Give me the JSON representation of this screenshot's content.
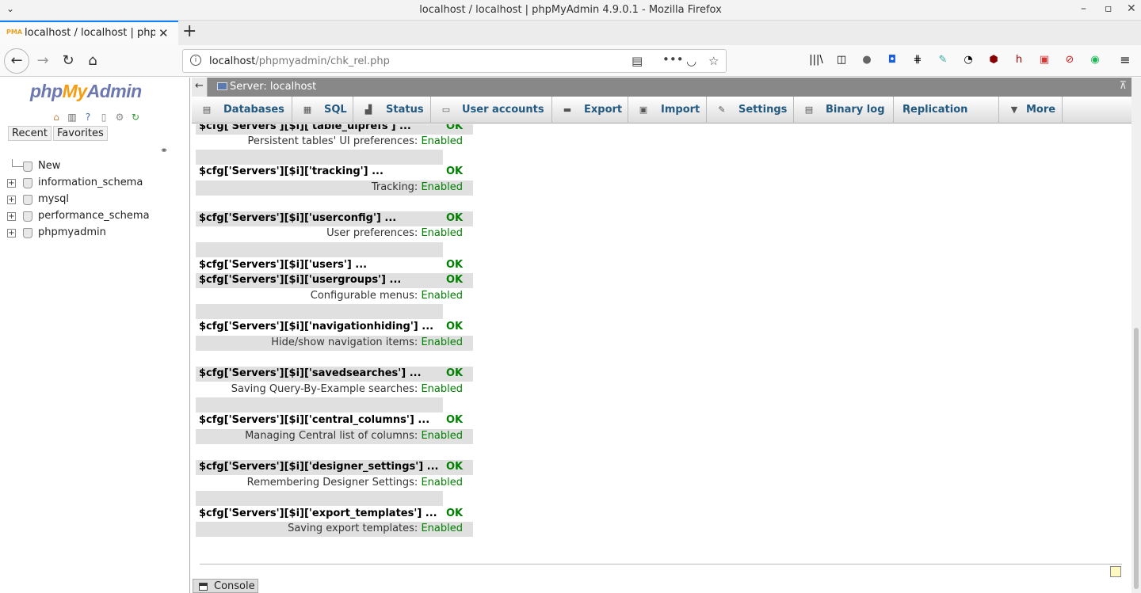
{
  "window": {
    "title": "localhost / localhost | phpMyAdmin 4.9.0.1 - Mozilla Firefox",
    "minimize": "–",
    "maximize": "▫",
    "close": "✕",
    "menu_chevron": "⌄"
  },
  "browser": {
    "tab_title": "localhost / localhost | phpMyAdmin",
    "tab_close": "✕",
    "newtab": "+",
    "url_host": "localhost",
    "url_path": "/phpmyadmin/chk_rel.php",
    "icons": [
      "back-icon",
      "forward-icon",
      "reload-icon",
      "home-icon",
      "reader-icon",
      "more-icon",
      "pocket-icon",
      "bookmark-star-icon",
      "library-icon",
      "sidebar-icon"
    ]
  },
  "pma": {
    "logo_php": "php",
    "logo_my": "My",
    "logo_admin": "Admin",
    "recent": "Recent",
    "favorites": "Favorites",
    "tree": [
      {
        "name": "New"
      },
      {
        "name": "information_schema"
      },
      {
        "name": "mysql"
      },
      {
        "name": "performance_schema"
      },
      {
        "name": "phpmyadmin"
      }
    ],
    "server": "Server: localhost",
    "menu": [
      {
        "label": "Databases",
        "icon": "database-icon"
      },
      {
        "label": "SQL",
        "icon": "sql-icon"
      },
      {
        "label": "Status",
        "icon": "status-icon"
      },
      {
        "label": "User accounts",
        "icon": "users-icon"
      },
      {
        "label": "Export",
        "icon": "export-icon"
      },
      {
        "label": "Import",
        "icon": "import-icon"
      },
      {
        "label": "Settings",
        "icon": "wrench-icon"
      },
      {
        "label": "Binary log",
        "icon": "binlog-icon"
      },
      {
        "label": "Replication",
        "icon": "replication-icon"
      },
      {
        "label": "More",
        "icon": "triangle-down-icon"
      }
    ],
    "console": "Console"
  },
  "checks": {
    "r0": {
      "key": "$cfg['Servers'][$i]['table_uiprefs'] ...",
      "status": "OK"
    },
    "r1": {
      "desc": "Persistent tables' UI preferences:",
      "value": "Enabled"
    },
    "r2": {
      "key": "$cfg['Servers'][$i]['tracking'] ...",
      "status": "OK"
    },
    "r3": {
      "desc": "Tracking:",
      "value": "Enabled"
    },
    "r4": {
      "key": "$cfg['Servers'][$i]['userconfig'] ...",
      "status": "OK"
    },
    "r5": {
      "desc": "User preferences:",
      "value": "Enabled"
    },
    "r6": {
      "key": "$cfg['Servers'][$i]['users'] ...",
      "status": "OK"
    },
    "r7": {
      "key": "$cfg['Servers'][$i]['usergroups'] ...",
      "status": "OK"
    },
    "r8": {
      "desc": "Configurable menus:",
      "value": "Enabled"
    },
    "r9": {
      "key": "$cfg['Servers'][$i]['navigationhiding'] ...",
      "status": "OK"
    },
    "r10": {
      "desc": "Hide/show navigation items:",
      "value": "Enabled"
    },
    "r11": {
      "key": "$cfg['Servers'][$i]['savedsearches'] ...",
      "status": "OK"
    },
    "r12": {
      "desc": "Saving Query-By-Example searches:",
      "value": "Enabled"
    },
    "r13": {
      "key": "$cfg['Servers'][$i]['central_columns'] ...",
      "status": "OK"
    },
    "r14": {
      "desc": "Managing Central list of columns:",
      "value": "Enabled"
    },
    "r15": {
      "key": "$cfg['Servers'][$i]['designer_settings'] ...",
      "status": "OK"
    },
    "r16": {
      "desc": "Remembering Designer Settings:",
      "value": "Enabled"
    },
    "r17": {
      "key": "$cfg['Servers'][$i]['export_templates'] ...",
      "status": "OK"
    },
    "r18": {
      "desc": "Saving export templates:",
      "value": "Enabled"
    }
  }
}
